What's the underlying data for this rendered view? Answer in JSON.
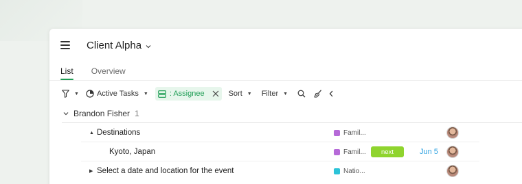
{
  "colors": {
    "accent_green": "#1f9d55",
    "chip_bg": "#e7f6ec",
    "status_next": "#8fd42e",
    "date_blue": "#2aa0e0",
    "project_family": "#b66ad8",
    "project_nation": "#2cc3d8"
  },
  "header": {
    "menu_icon": "hamburger-icon",
    "title": "Client Alpha",
    "title_caret_icon": "chevron-down-icon"
  },
  "tabs": [
    {
      "label": "List",
      "active": true
    },
    {
      "label": "Overview",
      "active": false
    }
  ],
  "toolbar": {
    "filter_icon": "funnel-icon",
    "active_tasks_label": "Active Tasks",
    "assignee_chip_label": ": Assignee",
    "sort_label": "Sort",
    "filter_label": "Filter",
    "search_icon": "search-icon",
    "clear_icon": "broom-icon",
    "collapse_icon": "chevron-left-icon"
  },
  "group": {
    "name": "Brandon Fisher",
    "count": "1"
  },
  "rows": [
    {
      "name": "Destinations",
      "expander": "down",
      "project": "Famil...",
      "project_color": "#b66ad8",
      "status": "",
      "date": ""
    },
    {
      "name": "Kyoto, Japan",
      "expander": "none",
      "project": "Famil...",
      "project_color": "#b66ad8",
      "status": "next",
      "date": "Jun 5"
    },
    {
      "name": "Select a date and location for the event",
      "expander": "right",
      "project": "Natio...",
      "project_color": "#2cc3d8",
      "status": "",
      "date": ""
    }
  ]
}
